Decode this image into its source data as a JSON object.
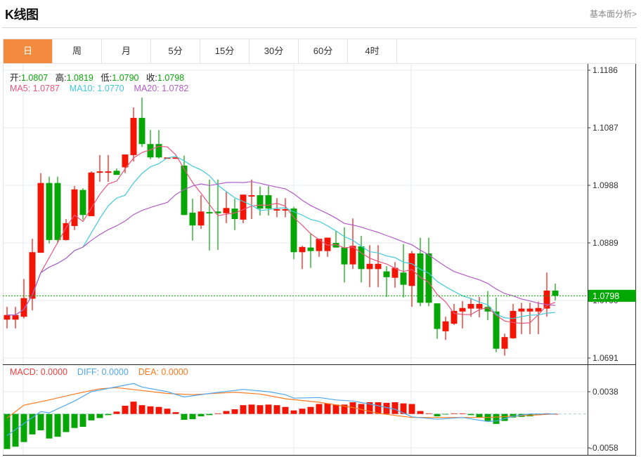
{
  "header": {
    "title": "K线图",
    "more_link": "基本面分析>"
  },
  "tabs": [
    {
      "label": "日",
      "active": true
    },
    {
      "label": "周",
      "active": false
    },
    {
      "label": "月",
      "active": false
    },
    {
      "label": "5分",
      "active": false
    },
    {
      "label": "15分",
      "active": false
    },
    {
      "label": "30分",
      "active": false
    },
    {
      "label": "60分",
      "active": false
    },
    {
      "label": "4时",
      "active": false
    }
  ],
  "ohlc_legend": {
    "open_label": "开:",
    "open": "1.0807",
    "high_label": "高:",
    "high": "1.0819",
    "low_label": "低:",
    "low": "1.0790",
    "close_label": "收:",
    "close": "1.0798"
  },
  "ma_legend": {
    "ma5": "MA5: 1.0787",
    "ma10": "MA10: 1.0770",
    "ma20": "MA20: 1.0782"
  },
  "macd_legend": {
    "macd": "MACD: 0.0000",
    "diff": "DIFF: 0.0000",
    "dea": "DEA: 0.0000"
  },
  "current_price_label": "1.0798",
  "colors": {
    "accent_tab": "#f38b3e",
    "up": "#f21505",
    "down": "#06a606",
    "ma5": "#e8557a",
    "ma10": "#3fc9d9",
    "ma20": "#b45cc8",
    "diff": "#4fa8ef",
    "dea": "#ff7a1f",
    "price_tag": "#00a800"
  },
  "chart_data": [
    {
      "type": "candlestick",
      "ylim": [
        1.0691,
        1.1186
      ],
      "y_ticks": [
        "1.1186",
        "1.1087",
        "1.0988",
        "1.0889",
        "1.0790",
        "1.0691"
      ],
      "grid": true,
      "ma_periods": [
        5,
        10,
        20
      ],
      "current_price": 1.0798,
      "candles": [
        [
          1.0757,
          1.0779,
          1.0742,
          1.0765
        ],
        [
          1.0757,
          1.0779,
          1.0742,
          1.0765
        ],
        [
          1.0762,
          1.0827,
          1.0759,
          1.0794
        ],
        [
          1.0793,
          1.0896,
          1.0773,
          1.0873
        ],
        [
          1.0872,
          1.1009,
          1.0872,
          1.0992
        ],
        [
          1.0992,
          1.1003,
          1.0888,
          1.0894
        ],
        [
          1.0992,
          1.1003,
          1.0888,
          1.0894
        ],
        [
          1.0894,
          1.093,
          1.0893,
          1.0923
        ],
        [
          1.0918,
          1.0987,
          1.0911,
          1.0981
        ],
        [
          1.098,
          1.0983,
          1.0929,
          1.0937
        ],
        [
          1.0935,
          1.1012,
          1.0935,
          1.101
        ],
        [
          1.101,
          1.104,
          1.0994,
          1.1012
        ],
        [
          1.101,
          1.104,
          1.0994,
          1.1012
        ],
        [
          1.1013,
          1.1017,
          1.1006,
          1.1006
        ],
        [
          1.1019,
          1.1041,
          1.1009,
          1.1041
        ],
        [
          1.104,
          1.1122,
          1.1029,
          1.1104
        ],
        [
          1.1104,
          1.1139,
          1.1054,
          1.1059
        ],
        [
          1.1059,
          1.1083,
          1.1033,
          1.1036
        ],
        [
          1.1059,
          1.1083,
          1.1034,
          1.1036
        ],
        [
          1.1035,
          1.1036,
          1.1035,
          1.1036
        ],
        [
          1.1035,
          1.1036,
          1.1035,
          1.1036
        ],
        [
          1.1022,
          1.1039,
          1.0937,
          1.0937
        ],
        [
          1.0941,
          1.0965,
          1.0893,
          1.0919
        ],
        [
          1.0919,
          1.0971,
          1.0913,
          1.0943
        ],
        [
          1.0942,
          1.0998,
          1.0876,
          1.094
        ],
        [
          1.0943,
          1.0998,
          1.0877,
          1.094
        ],
        [
          1.094,
          1.0977,
          1.0923,
          1.0949
        ],
        [
          1.0948,
          1.0965,
          1.0911,
          1.093
        ],
        [
          1.0929,
          1.0972,
          1.0923,
          1.0972
        ],
        [
          1.097,
          1.0998,
          1.093,
          1.0971
        ],
        [
          1.0971,
          1.0986,
          1.0936,
          1.0948
        ],
        [
          1.0971,
          1.0987,
          1.0936,
          1.0948
        ],
        [
          1.0946,
          1.0966,
          1.0933,
          1.0947
        ],
        [
          1.0946,
          1.0966,
          1.0933,
          1.0947
        ],
        [
          1.0948,
          1.0951,
          1.0861,
          1.0873
        ],
        [
          1.0873,
          1.0884,
          1.0844,
          1.0882
        ],
        [
          1.0881,
          1.0906,
          1.0846,
          1.0875
        ],
        [
          1.0875,
          1.0896,
          1.0865,
          1.0896
        ],
        [
          1.0875,
          1.0898,
          1.0865,
          1.0898
        ],
        [
          1.0889,
          1.091,
          1.0881,
          1.0881
        ],
        [
          1.0881,
          1.0916,
          1.0821,
          1.0852
        ],
        [
          1.0852,
          1.0931,
          1.0844,
          1.0884
        ],
        [
          1.0883,
          1.0901,
          1.0821,
          1.0844
        ],
        [
          1.0844,
          1.0885,
          1.0813,
          1.0853
        ],
        [
          1.0844,
          1.0885,
          1.0813,
          1.0853
        ],
        [
          1.084,
          1.0849,
          1.0796,
          1.083
        ],
        [
          1.0829,
          1.0856,
          1.0812,
          1.0846
        ],
        [
          1.0838,
          1.0887,
          1.0795,
          1.0817
        ],
        [
          1.0815,
          1.0875,
          1.0779,
          1.0871
        ],
        [
          1.0871,
          1.0898,
          1.078,
          1.0786
        ],
        [
          1.0871,
          1.0898,
          1.078,
          1.0786
        ],
        [
          1.0785,
          1.0785,
          1.0724,
          1.0741
        ],
        [
          1.0737,
          1.0762,
          1.0722,
          1.0754
        ],
        [
          1.075,
          1.0784,
          1.0748,
          1.0772
        ],
        [
          1.0771,
          1.0789,
          1.0742,
          1.0777
        ],
        [
          1.0776,
          1.0794,
          1.0762,
          1.0784
        ],
        [
          1.0776,
          1.0796,
          1.0761,
          1.0784
        ],
        [
          1.0779,
          1.0806,
          1.0756,
          1.0771
        ],
        [
          1.0771,
          1.0795,
          1.0701,
          1.0707
        ],
        [
          1.0707,
          1.0733,
          1.0695,
          1.0727
        ],
        [
          1.0725,
          1.0784,
          1.0724,
          1.0772
        ],
        [
          1.0771,
          1.0786,
          1.0732,
          1.0776
        ],
        [
          1.0771,
          1.0786,
          1.0732,
          1.0776
        ],
        [
          1.0771,
          1.0788,
          1.0732,
          1.0777
        ],
        [
          1.0776,
          1.0838,
          1.0762,
          1.0807
        ],
        [
          1.0807,
          1.0819,
          1.079,
          1.0798
        ]
      ]
    },
    {
      "type": "bar",
      "ylim": [
        -0.0058,
        0.0038
      ],
      "y_ticks": [
        "0.0038",
        "-0.0058"
      ],
      "macd_hist": [
        -0.006,
        -0.0056,
        -0.0048,
        -0.0035,
        -0.0028,
        -0.0042,
        -0.0039,
        -0.0031,
        -0.0024,
        -0.0022,
        -0.0011,
        -0.0007,
        -0.0002,
        0.0004,
        0.0014,
        0.0021,
        0.0015,
        0.0013,
        0.0012,
        0.0009,
        0.0003,
        -0.001,
        -0.0009,
        -0.0004,
        -0.0002,
        0.0001,
        0.0005,
        0.0008,
        0.0015,
        0.0016,
        0.0015,
        0.0016,
        0.0015,
        0.0012,
        0.0006,
        0.0009,
        0.0012,
        0.0017,
        0.0018,
        0.0016,
        0.0016,
        0.002,
        0.0017,
        0.002,
        0.002,
        0.0019,
        0.002,
        0.0018,
        0.0017,
        0.0005,
        0.0001,
        -0.0004,
        -0.0001,
        0.0001,
        0.0001,
        -0.0002,
        -0.0006,
        -0.0012,
        -0.0017,
        -0.0012,
        -0.0006,
        -0.0005,
        -0.0004,
        -0.0002,
        0.0001,
        0.0
      ],
      "diff": [
        [
          0,
          -0.0037
        ],
        [
          4,
          0.0004
        ],
        [
          5,
          0.0002
        ],
        [
          8,
          0.0022
        ],
        [
          10,
          0.0038
        ],
        [
          15,
          0.0052
        ],
        [
          16,
          0.0046
        ],
        [
          19,
          0.0038
        ],
        [
          21,
          0.0029
        ],
        [
          24,
          0.0035
        ],
        [
          28,
          0.0042
        ],
        [
          31,
          0.0038
        ],
        [
          33,
          0.0033
        ],
        [
          34,
          0.0027
        ],
        [
          37,
          0.0028
        ],
        [
          39,
          0.0024
        ],
        [
          41,
          0.0022
        ],
        [
          43,
          0.0017
        ],
        [
          46,
          0.0008
        ],
        [
          48,
          -0.0005
        ],
        [
          51,
          -0.0009
        ],
        [
          54,
          -0.0006
        ],
        [
          57,
          -0.0013
        ],
        [
          58,
          -0.0012
        ],
        [
          60,
          -0.0004
        ],
        [
          62,
          0.0
        ],
        [
          65,
          0.0
        ]
      ],
      "dea": [
        [
          0,
          -0.0007
        ],
        [
          2,
          0.0015
        ],
        [
          5,
          0.0024
        ],
        [
          8,
          0.0034
        ],
        [
          11,
          0.0043
        ],
        [
          13,
          0.0045
        ],
        [
          16,
          0.004
        ],
        [
          19,
          0.0035
        ],
        [
          22,
          0.0033
        ],
        [
          27,
          0.0037
        ],
        [
          30,
          0.0034
        ],
        [
          33,
          0.0026
        ],
        [
          37,
          0.002
        ],
        [
          41,
          0.0011
        ],
        [
          44,
          0.0001
        ],
        [
          48,
          -0.0006
        ],
        [
          53,
          -0.0006
        ],
        [
          57,
          -0.0006
        ],
        [
          61,
          -0.0003
        ],
        [
          65,
          0.0
        ]
      ]
    }
  ]
}
